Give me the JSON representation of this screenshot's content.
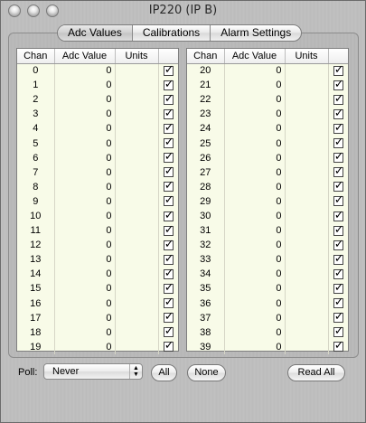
{
  "window": {
    "title": "IP220 (IP B)"
  },
  "tabs": [
    {
      "label": "Adc Values",
      "active": true
    },
    {
      "label": "Calibrations",
      "active": false
    },
    {
      "label": "Alarm Settings",
      "active": false
    }
  ],
  "table": {
    "headers": {
      "chan": "Chan",
      "adc_value": "Adc Value",
      "units": "Units"
    },
    "left_rows": [
      {
        "chan": "0",
        "value": "0",
        "units": "",
        "checked": true
      },
      {
        "chan": "1",
        "value": "0",
        "units": "",
        "checked": true
      },
      {
        "chan": "2",
        "value": "0",
        "units": "",
        "checked": true
      },
      {
        "chan": "3",
        "value": "0",
        "units": "",
        "checked": true
      },
      {
        "chan": "4",
        "value": "0",
        "units": "",
        "checked": true
      },
      {
        "chan": "5",
        "value": "0",
        "units": "",
        "checked": true
      },
      {
        "chan": "6",
        "value": "0",
        "units": "",
        "checked": true
      },
      {
        "chan": "7",
        "value": "0",
        "units": "",
        "checked": true
      },
      {
        "chan": "8",
        "value": "0",
        "units": "",
        "checked": true
      },
      {
        "chan": "9",
        "value": "0",
        "units": "",
        "checked": true
      },
      {
        "chan": "10",
        "value": "0",
        "units": "",
        "checked": true
      },
      {
        "chan": "11",
        "value": "0",
        "units": "",
        "checked": true
      },
      {
        "chan": "12",
        "value": "0",
        "units": "",
        "checked": true
      },
      {
        "chan": "13",
        "value": "0",
        "units": "",
        "checked": true
      },
      {
        "chan": "14",
        "value": "0",
        "units": "",
        "checked": true
      },
      {
        "chan": "15",
        "value": "0",
        "units": "",
        "checked": true
      },
      {
        "chan": "16",
        "value": "0",
        "units": "",
        "checked": true
      },
      {
        "chan": "17",
        "value": "0",
        "units": "",
        "checked": true
      },
      {
        "chan": "18",
        "value": "0",
        "units": "",
        "checked": true
      },
      {
        "chan": "19",
        "value": "0",
        "units": "",
        "checked": true
      }
    ],
    "right_rows": [
      {
        "chan": "20",
        "value": "0",
        "units": "",
        "checked": true
      },
      {
        "chan": "21",
        "value": "0",
        "units": "",
        "checked": true
      },
      {
        "chan": "22",
        "value": "0",
        "units": "",
        "checked": true
      },
      {
        "chan": "23",
        "value": "0",
        "units": "",
        "checked": true
      },
      {
        "chan": "24",
        "value": "0",
        "units": "",
        "checked": true
      },
      {
        "chan": "25",
        "value": "0",
        "units": "",
        "checked": true
      },
      {
        "chan": "26",
        "value": "0",
        "units": "",
        "checked": true
      },
      {
        "chan": "27",
        "value": "0",
        "units": "",
        "checked": true
      },
      {
        "chan": "28",
        "value": "0",
        "units": "",
        "checked": true
      },
      {
        "chan": "29",
        "value": "0",
        "units": "",
        "checked": true
      },
      {
        "chan": "30",
        "value": "0",
        "units": "",
        "checked": true
      },
      {
        "chan": "31",
        "value": "0",
        "units": "",
        "checked": true
      },
      {
        "chan": "32",
        "value": "0",
        "units": "",
        "checked": true
      },
      {
        "chan": "33",
        "value": "0",
        "units": "",
        "checked": true
      },
      {
        "chan": "34",
        "value": "0",
        "units": "",
        "checked": true
      },
      {
        "chan": "35",
        "value": "0",
        "units": "",
        "checked": true
      },
      {
        "chan": "36",
        "value": "0",
        "units": "",
        "checked": true
      },
      {
        "chan": "37",
        "value": "0",
        "units": "",
        "checked": true
      },
      {
        "chan": "38",
        "value": "0",
        "units": "",
        "checked": true
      },
      {
        "chan": "39",
        "value": "0",
        "units": "",
        "checked": true
      }
    ]
  },
  "controls": {
    "poll_label": "Poll:",
    "poll_value": "Never",
    "select_arrows_icon": "updown-arrows-icon",
    "all_button": "All",
    "none_button": "None",
    "read_all_button": "Read All"
  }
}
